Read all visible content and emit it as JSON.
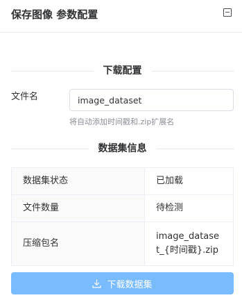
{
  "header": {
    "title": "保存图像 参数配置",
    "collapse_icon": "minus-square-icon"
  },
  "download_config": {
    "section_title": "下载配置",
    "filename_label": "文件名",
    "filename_value": "image_dataset",
    "hint": "将自动添加时间戳和.zip扩展名"
  },
  "dataset_info": {
    "section_title": "数据集信息",
    "rows": [
      {
        "key": "数据集状态",
        "value": "已加载"
      },
      {
        "key": "文件数量",
        "value": "待检测"
      },
      {
        "key": "压缩包名",
        "value": "image_dataset_{时间戳}.zip"
      }
    ]
  },
  "actions": {
    "download_label": "下载数据集",
    "download_icon": "download-icon",
    "button_color": "#79bbff"
  }
}
